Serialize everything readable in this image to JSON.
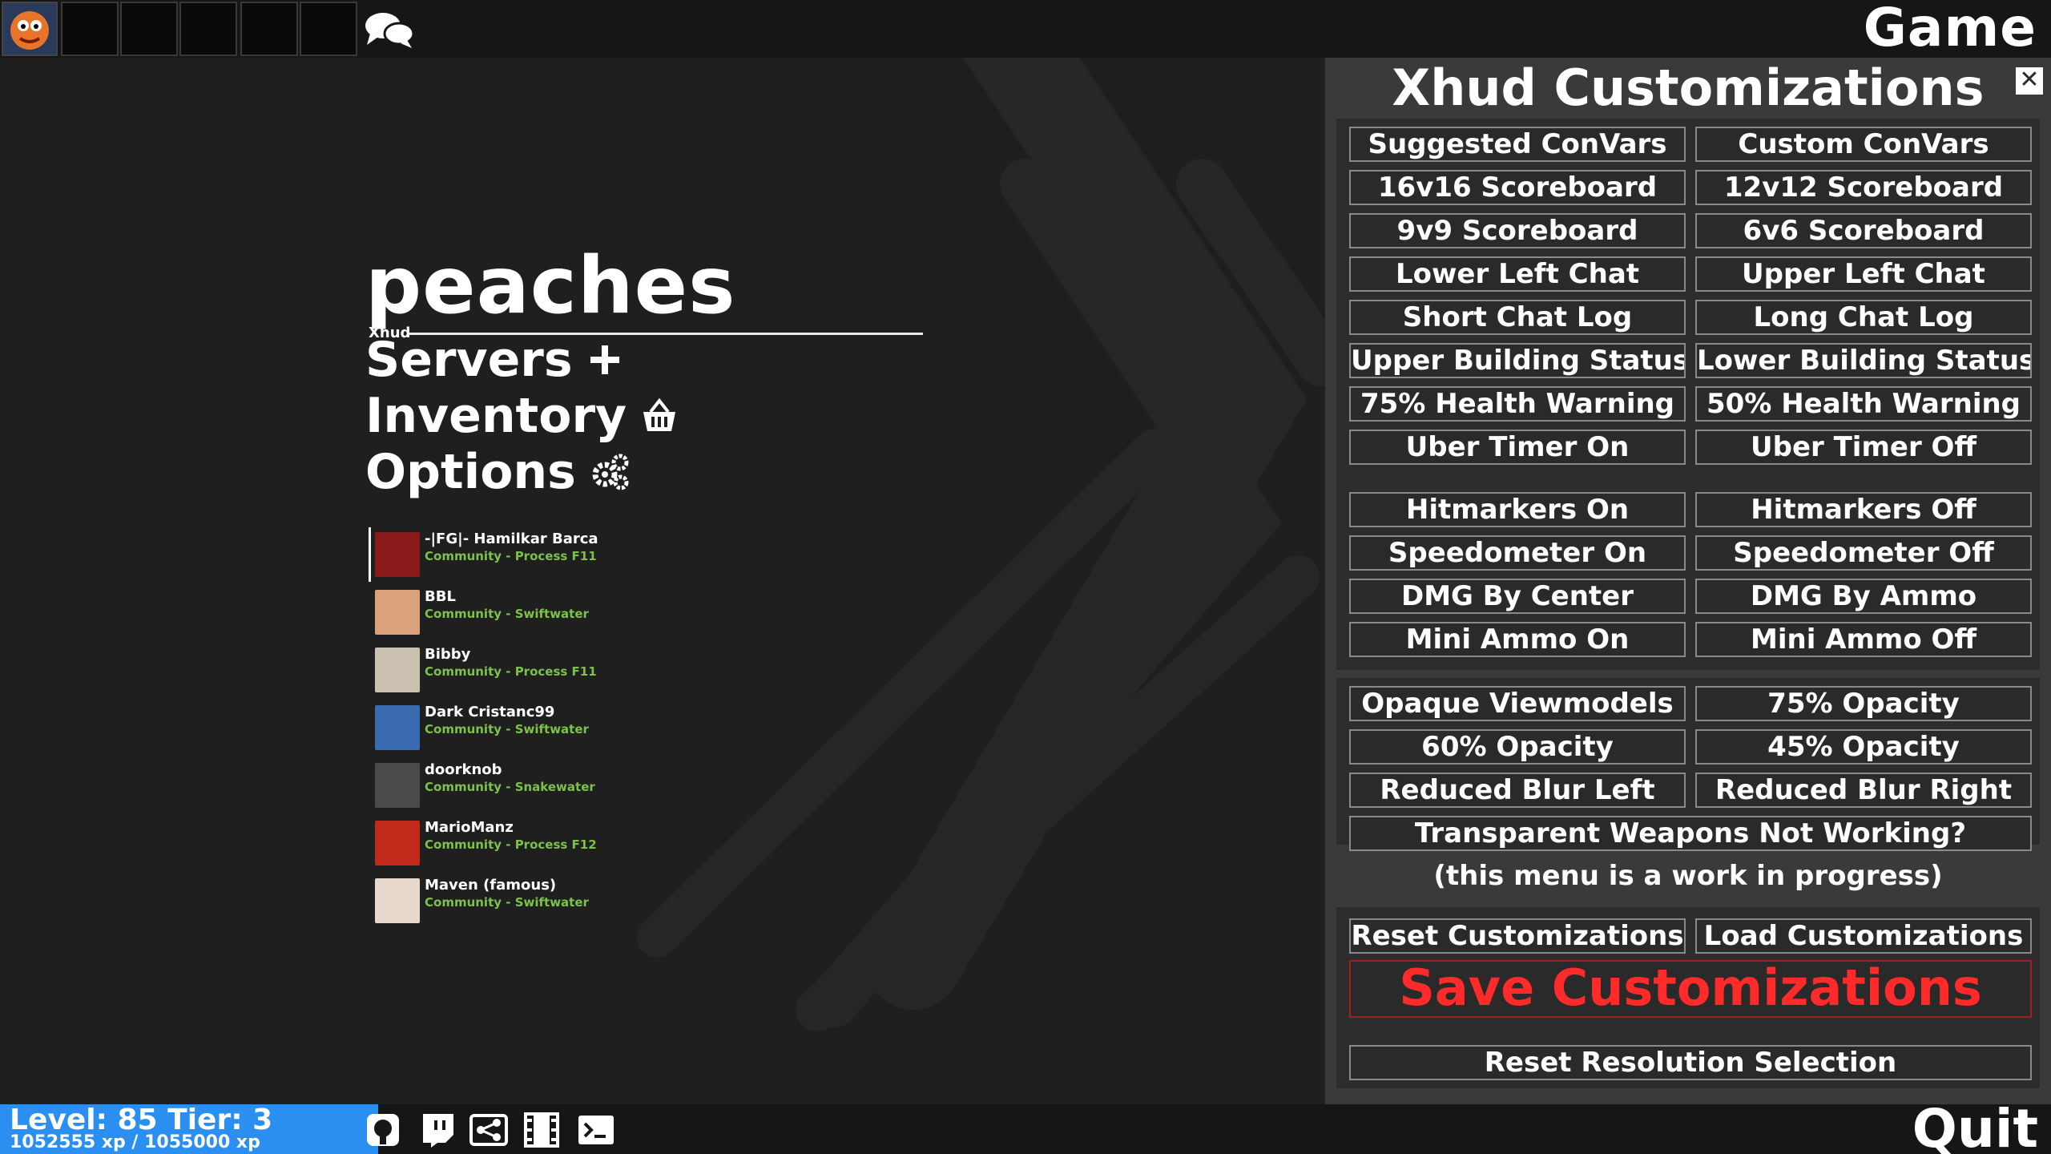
{
  "topbar": {
    "game_label": "Game"
  },
  "menu": {
    "brand": "peaches",
    "brand_sub": "Xhud",
    "items": [
      {
        "label": "Servers",
        "icon": "plus-icon"
      },
      {
        "label": "Inventory",
        "icon": "basket-icon"
      },
      {
        "label": "Options",
        "icon": "gears-icon"
      }
    ]
  },
  "friends": [
    {
      "name": "-|FG|- Hamilkar Barca",
      "status": "Community - Process F11",
      "color": "#8a1a1a"
    },
    {
      "name": "BBL",
      "status": "Community - Swiftwater",
      "color": "#d9a27a"
    },
    {
      "name": "Bibby",
      "status": "Community - Process F11",
      "color": "#c9c0b0"
    },
    {
      "name": "Dark Cristanc99",
      "status": "Community - Swiftwater",
      "color": "#3a6ab0"
    },
    {
      "name": "doorknob",
      "status": "Community - Snakewater",
      "color": "#4a4a4a"
    },
    {
      "name": "MarioManz",
      "status": "Community - Process F12",
      "color": "#c02a1a"
    },
    {
      "name": "Maven (famous)",
      "status": "Community - Swiftwater",
      "color": "#e6d8cc"
    }
  ],
  "panel": {
    "title": "Xhud Customizations",
    "close": "✕",
    "section1": [
      [
        "Suggested ConVars",
        "Custom ConVars"
      ],
      [
        "16v16 Scoreboard",
        "12v12 Scoreboard"
      ],
      [
        "9v9 Scoreboard",
        "6v6 Scoreboard"
      ],
      [
        "Lower Left Chat",
        "Upper Left Chat"
      ],
      [
        "Short Chat Log",
        "Long Chat Log"
      ],
      [
        "Upper Building Status",
        "Lower Building Status"
      ],
      [
        "75% Health Warning",
        "50% Health Warning"
      ],
      [
        "Uber Timer On",
        "Uber Timer Off"
      ]
    ],
    "section2": [
      [
        "Hitmarkers On",
        "Hitmarkers Off"
      ],
      [
        "Speedometer On",
        "Speedometer Off"
      ],
      [
        "DMG By Center",
        "DMG By Ammo"
      ],
      [
        "Mini Ammo On",
        "Mini Ammo Off"
      ]
    ],
    "section3": [
      [
        "Opaque Viewmodels",
        "75% Opacity"
      ],
      [
        "60% Opacity",
        "45% Opacity"
      ],
      [
        "Reduced Blur Left",
        "Reduced Blur Right"
      ]
    ],
    "transparent_weapons": "Transparent Weapons Not Working?",
    "wip_note": "(this menu is a work in progress)",
    "reset_customizations": "Reset Customizations",
    "load_customizations": "Load Customizations",
    "save_customizations": "Save Customizations",
    "reset_resolution": "Reset Resolution Selection",
    "save_color": "#ff2a2a"
  },
  "bottombar": {
    "level": "Level: 85 Tier: 3",
    "xp": "1052555 xp / 1055000 xp",
    "icons": [
      "github-icon",
      "twitch-icon",
      "share-icon",
      "film-icon",
      "console-icon"
    ],
    "quit_label": "Quit",
    "accent": "#2a8ff0"
  }
}
